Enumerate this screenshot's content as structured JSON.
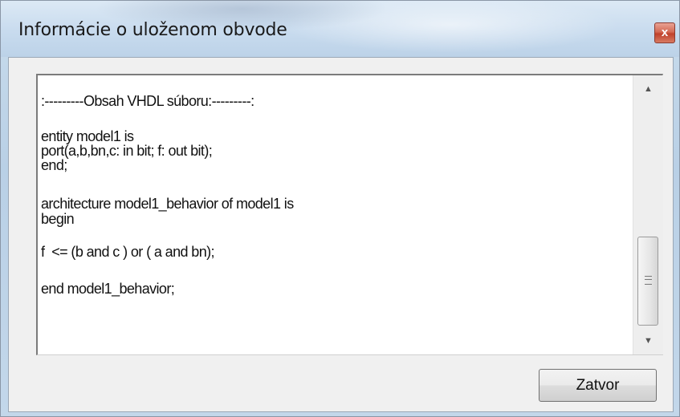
{
  "window": {
    "title": "Informácie o uloženom obvode",
    "close_glyph": "x"
  },
  "content": {
    "lines": [
      ":---------Obsah VHDL súboru:---------:",
      "",
      "entity model1 is",
      "port(a,b,bn,c: in bit; f: out bit);",
      "end;",
      "",
      "architecture model1_behavior of model1 is",
      "begin",
      "",
      "f  <= (b and c ) or ( a and bn);",
      "",
      "end model1_behavior;"
    ]
  },
  "scrollbar": {
    "up_arrow": "▲",
    "down_arrow": "▼"
  },
  "buttons": {
    "close_label": "Zatvor"
  }
}
